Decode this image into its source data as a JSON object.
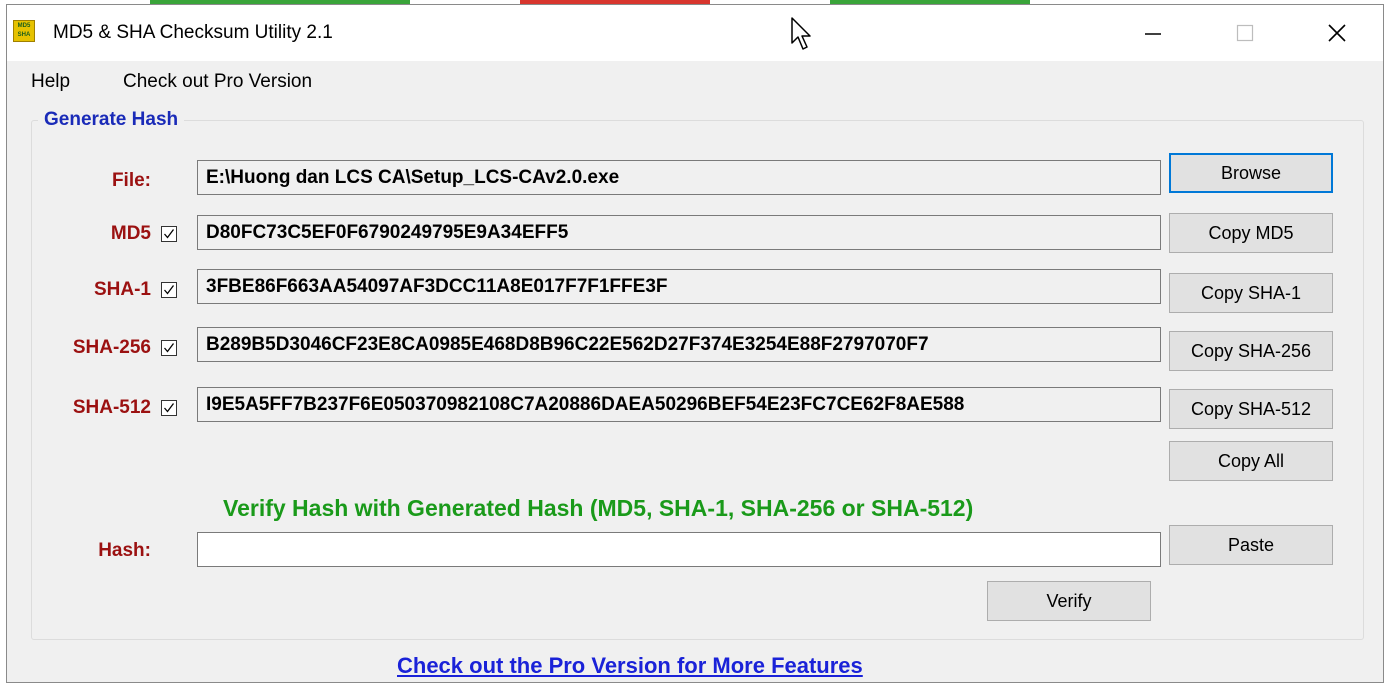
{
  "window": {
    "title": "MD5 & SHA Checksum Utility 2.1",
    "icon_text_top": "MD5",
    "icon_text_bottom": "SHA"
  },
  "menu": {
    "items": [
      "Help",
      "Check out Pro Version"
    ]
  },
  "generate": {
    "group_title": "Generate Hash",
    "file_label": "File:",
    "file_path": "E:\\Huong dan LCS CA\\Setup_LCS-CAv2.0.exe",
    "browse_label": "Browse",
    "hashes": [
      {
        "label": "MD5",
        "checked": true,
        "value": "D80FC73C5EF0F6790249795E9A34EFF5",
        "button": "Copy MD5"
      },
      {
        "label": "SHA-1",
        "checked": true,
        "value": "3FBE86F663AA54097AF3DCC11A8E017F7F1FFE3F",
        "button": "Copy SHA-1"
      },
      {
        "label": "SHA-256",
        "checked": true,
        "value": "B289B5D3046CF23E8CA0985E468D8B96C22E562D27F374E3254E88F2797070F7",
        "button": "Copy SHA-256"
      },
      {
        "label": "SHA-512",
        "checked": true,
        "value": "I9E5A5FF7B237F6E050370982108C7A20886DAEA50296BEF54E23FC7CE62F8AE588",
        "button": "Copy SHA-512"
      }
    ],
    "copy_all_label": "Copy All"
  },
  "verify": {
    "title": "Verify Hash with Generated Hash (MD5, SHA-1, SHA-256 or SHA-512)",
    "hash_label": "Hash:",
    "hash_value": "",
    "paste_label": "Paste",
    "verify_label": "Verify"
  },
  "footer": {
    "pro_link": "Check out the Pro Version for More Features"
  },
  "colors": {
    "label_red": "#9b1111",
    "group_blue": "#1a2bb8",
    "verify_green": "#1a9a1a",
    "link_blue": "#1a22d8",
    "default_button_border": "#0078d7"
  }
}
